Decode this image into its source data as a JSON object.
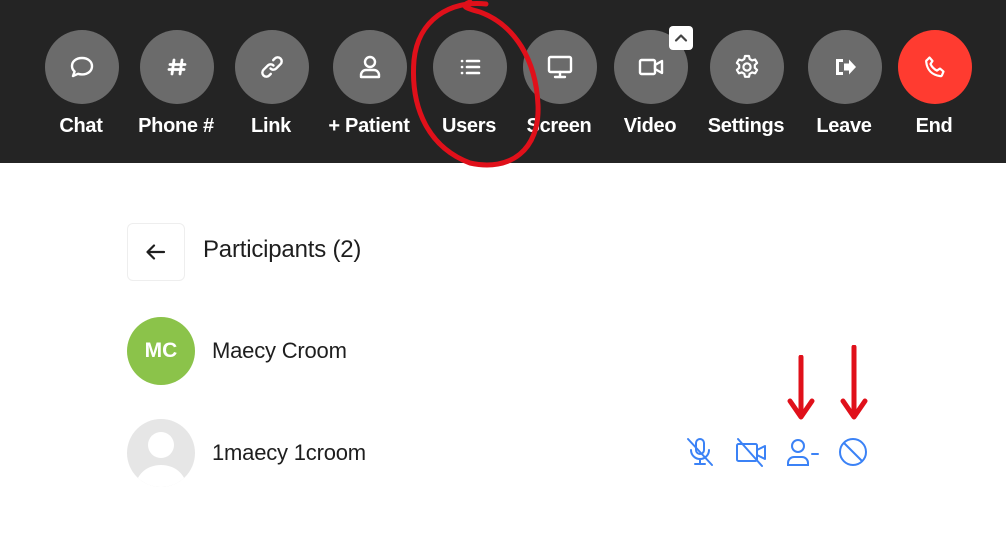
{
  "toolbar": {
    "buttons": [
      {
        "id": "chat",
        "label": "Chat",
        "icon": "chat-bubble-icon"
      },
      {
        "id": "phone",
        "label": "Phone #",
        "icon": "hash-icon"
      },
      {
        "id": "link",
        "label": "Link",
        "icon": "link-icon"
      },
      {
        "id": "patient",
        "label": "+ Patient",
        "icon": "user-icon"
      },
      {
        "id": "users",
        "label": "Users",
        "icon": "list-icon"
      },
      {
        "id": "screen",
        "label": "Screen",
        "icon": "monitor-icon"
      },
      {
        "id": "video",
        "label": "Video",
        "icon": "video-camera-icon"
      },
      {
        "id": "settings",
        "label": "Settings",
        "icon": "gear-icon"
      },
      {
        "id": "leave",
        "label": "Leave",
        "icon": "leave-icon"
      },
      {
        "id": "end",
        "label": "End",
        "icon": "phone-hangup-icon"
      }
    ],
    "video_options_icon": "chevron-up-icon"
  },
  "panel": {
    "title": "Participants (2)",
    "back_icon": "arrow-left-icon",
    "participants": [
      {
        "initials": "MC",
        "name": "Maecy Croom"
      },
      {
        "name": "1maecy 1croom",
        "controls": [
          "mic-muted-icon",
          "video-off-icon",
          "remove-user-icon",
          "block-icon"
        ]
      }
    ]
  },
  "colors": {
    "toolbar_bg": "#242424",
    "button_bg": "#6b6b6b",
    "end_button": "#ff3b30",
    "avatar_green": "#8bc34a",
    "control_blue": "#3b82f6",
    "annotation_red": "#e0101a"
  }
}
